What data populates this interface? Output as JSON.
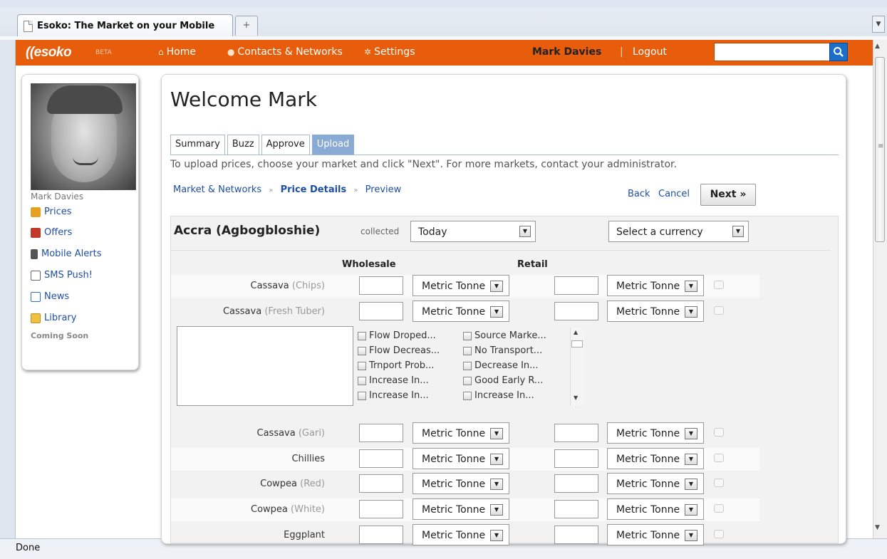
{
  "browser": {
    "tab_title": "Esoko: The Market on your Mobile",
    "new_tab_symbol": "+",
    "status_text": "Done"
  },
  "nav": {
    "logo": "esoko",
    "beta": "BETA",
    "links": [
      {
        "label": "Home",
        "icon": "home-icon"
      },
      {
        "label": "Contacts & Networks",
        "icon": "contacts-icon"
      },
      {
        "label": "Settings",
        "icon": "gear-icon"
      }
    ],
    "user": "Mark Davies",
    "logout": "Logout",
    "search_placeholder": ""
  },
  "sidebar": {
    "user_name": "Mark Davies",
    "links": [
      {
        "label": "Prices",
        "icon": "prices-icon",
        "color": "#e8a020"
      },
      {
        "label": "Offers",
        "icon": "offers-icon",
        "color": "#c0392b"
      },
      {
        "label": "Mobile Alerts",
        "icon": "mobile-icon",
        "color": "#555555"
      },
      {
        "label": "SMS Push!",
        "icon": "sms-icon",
        "color": "#666666"
      },
      {
        "label": "News",
        "icon": "news-icon",
        "color": "#2a6fc9"
      },
      {
        "label": "Library",
        "icon": "folder-icon",
        "color": "#e8b020"
      }
    ],
    "coming_soon": "Coming Soon"
  },
  "main": {
    "welcome": "Welcome Mark",
    "tabs": [
      {
        "label": "Summary",
        "active": false
      },
      {
        "label": "Buzz",
        "active": false
      },
      {
        "label": "Approve",
        "active": false
      },
      {
        "label": "Upload",
        "active": true
      }
    ],
    "instructions": "To upload prices, choose your market and click \"Next\". For more markets, contact your administrator.",
    "breadcrumb": {
      "step1": "Market & Networks",
      "step2": "Price Details",
      "step3": "Preview",
      "separator": "»"
    },
    "back": "Back",
    "cancel": "Cancel",
    "next": "Next »"
  },
  "form": {
    "market": "Accra (Agbogbloshie)",
    "collected_label": "collected",
    "collected_value": "Today",
    "currency_value": "Select a currency",
    "wholesale_header": "Wholesale",
    "retail_header": "Retail",
    "unit_default": "Metric Tonne",
    "products": [
      {
        "name": "Cassava",
        "variety": "(Chips)"
      },
      {
        "name": "Cassava",
        "variety": "(Fresh Tuber)"
      },
      {
        "name": "Cassava",
        "variety": "(Gari)"
      },
      {
        "name": "Chillies",
        "variety": ""
      },
      {
        "name": "Cowpea",
        "variety": "(Red)"
      },
      {
        "name": "Cowpea",
        "variety": "(White)"
      },
      {
        "name": "Eggplant",
        "variety": ""
      }
    ],
    "checklist": [
      "Flow Droped...",
      "Flow Decreas...",
      "Trnport Prob...",
      "Increase In...",
      "Increase In...",
      "Source Marke...",
      "No Transport...",
      "Decrease In...",
      "Good Early R...",
      "Increase In..."
    ]
  }
}
